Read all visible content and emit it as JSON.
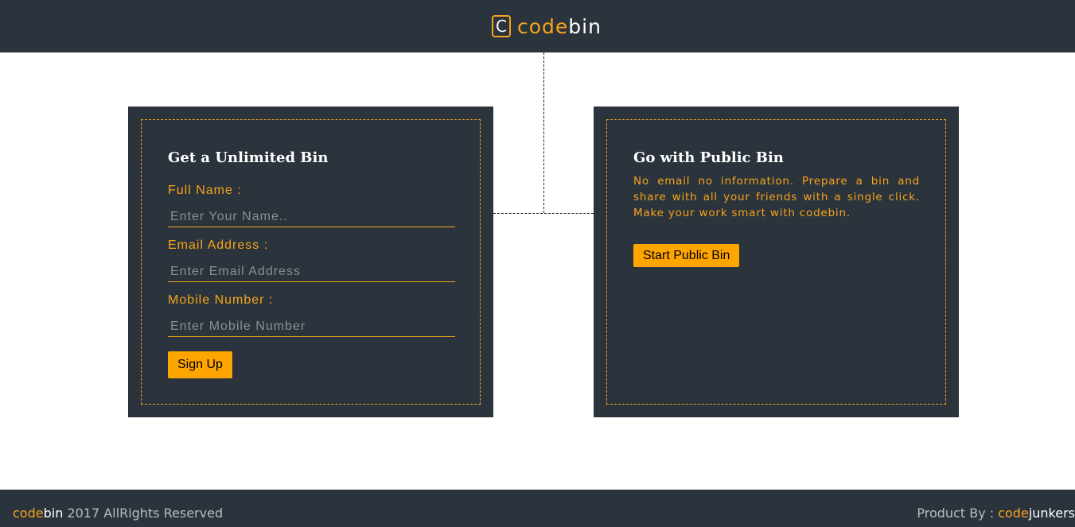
{
  "header": {
    "logo_mark": "C",
    "logo_accent": "code",
    "logo_light": "bin"
  },
  "unlimited": {
    "title": "Get a Unlimited Bin",
    "name_label": "Full Name :",
    "name_placeholder": "Enter Your Name..",
    "email_label": "Email Address :",
    "email_placeholder": "Enter Email Address",
    "mobile_label": "Mobile Number :",
    "mobile_placeholder": "Enter Mobile Number",
    "signup_label": "Sign Up"
  },
  "public": {
    "title": "Go with Public Bin",
    "description": "No email no information. Prepare a bin and share with all your friends with a single click. Make your work smart with codebin.",
    "start_label": "Start Public Bin"
  },
  "footer": {
    "brand_accent": "code",
    "brand_light": "bin",
    "copyright_text": " 2017 AllRights Reserved",
    "product_by": "Product By : ",
    "company_accent": "code",
    "company_light": "junkers"
  },
  "colors": {
    "dark": "#2b343c",
    "accent": "#f7a31b",
    "button": "#ffa500"
  }
}
